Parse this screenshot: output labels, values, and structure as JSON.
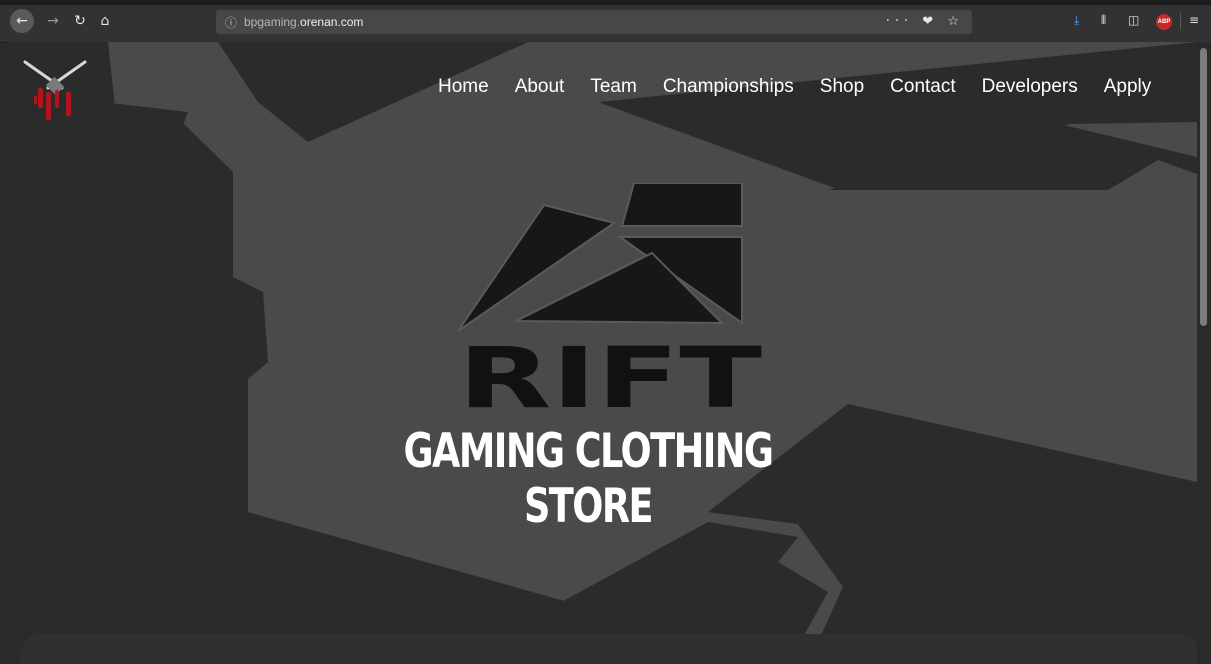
{
  "browser": {
    "url_prefix": "bpgaming.",
    "url_domain": "orenan.com",
    "actions": "··· ❤ ☆"
  },
  "nav": {
    "items": [
      "Home",
      "About",
      "Team",
      "Championships",
      "Shop",
      "Contact",
      "Developers",
      "Apply"
    ]
  },
  "hero": {
    "logo_text": "RIFT",
    "title": "GAMING CLOTHING STORE"
  },
  "colors": {
    "background_dark": "#2b2b2b",
    "background_light": "#4a4a4a",
    "text": "#ffffff",
    "blood_red": "#b3151f"
  }
}
